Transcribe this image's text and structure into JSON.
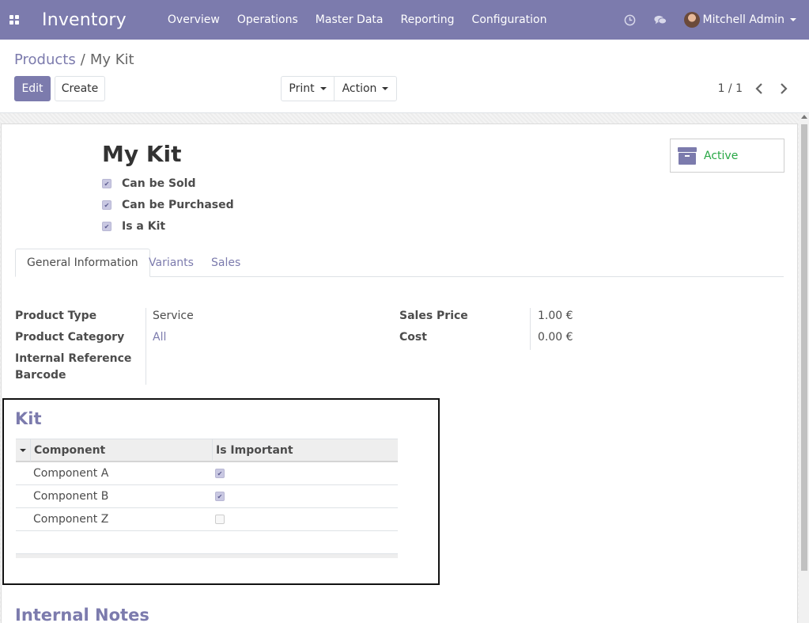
{
  "navbar": {
    "app_name": "Inventory",
    "menu": [
      "Overview",
      "Operations",
      "Master Data",
      "Reporting",
      "Configuration"
    ],
    "user_name": "Mitchell Admin",
    "bg_color": "#7c7bad",
    "icons": [
      "apps-icon",
      "clock-icon",
      "chat-icon"
    ]
  },
  "breadcrumb": {
    "parent": "Products",
    "separator": "/",
    "current": "My Kit"
  },
  "toolbar": {
    "edit_label": "Edit",
    "create_label": "Create",
    "print_label": "Print",
    "action_label": "Action"
  },
  "pager": {
    "value": "1 / 1"
  },
  "product": {
    "name": "My Kit",
    "checkboxes": [
      {
        "label": "Can be Sold",
        "checked": true
      },
      {
        "label": "Can be Purchased",
        "checked": true
      },
      {
        "label": "Is a Kit",
        "checked": true
      }
    ],
    "active_label": "Active"
  },
  "tabs": [
    "General Information",
    "Variants",
    "Sales"
  ],
  "fields": {
    "product_type_label": "Product Type",
    "product_type_value": "Service",
    "product_category_label": "Product Category",
    "product_category_value": "All",
    "internal_reference_label": "Internal Reference",
    "barcode_label": "Barcode",
    "sales_price_label": "Sales Price",
    "sales_price_value": "1.00 €",
    "cost_label": "Cost",
    "cost_value": "0.00 €"
  },
  "kit": {
    "title": "Kit",
    "columns": [
      "Component",
      "Is Important"
    ],
    "rows": [
      {
        "component": "Component A",
        "important": true
      },
      {
        "component": "Component B",
        "important": true
      },
      {
        "component": "Component Z",
        "important": false
      }
    ]
  },
  "notes": {
    "title": "Internal Notes"
  },
  "colors": {
    "accent": "#7c7bad",
    "active_green": "#28a745"
  }
}
